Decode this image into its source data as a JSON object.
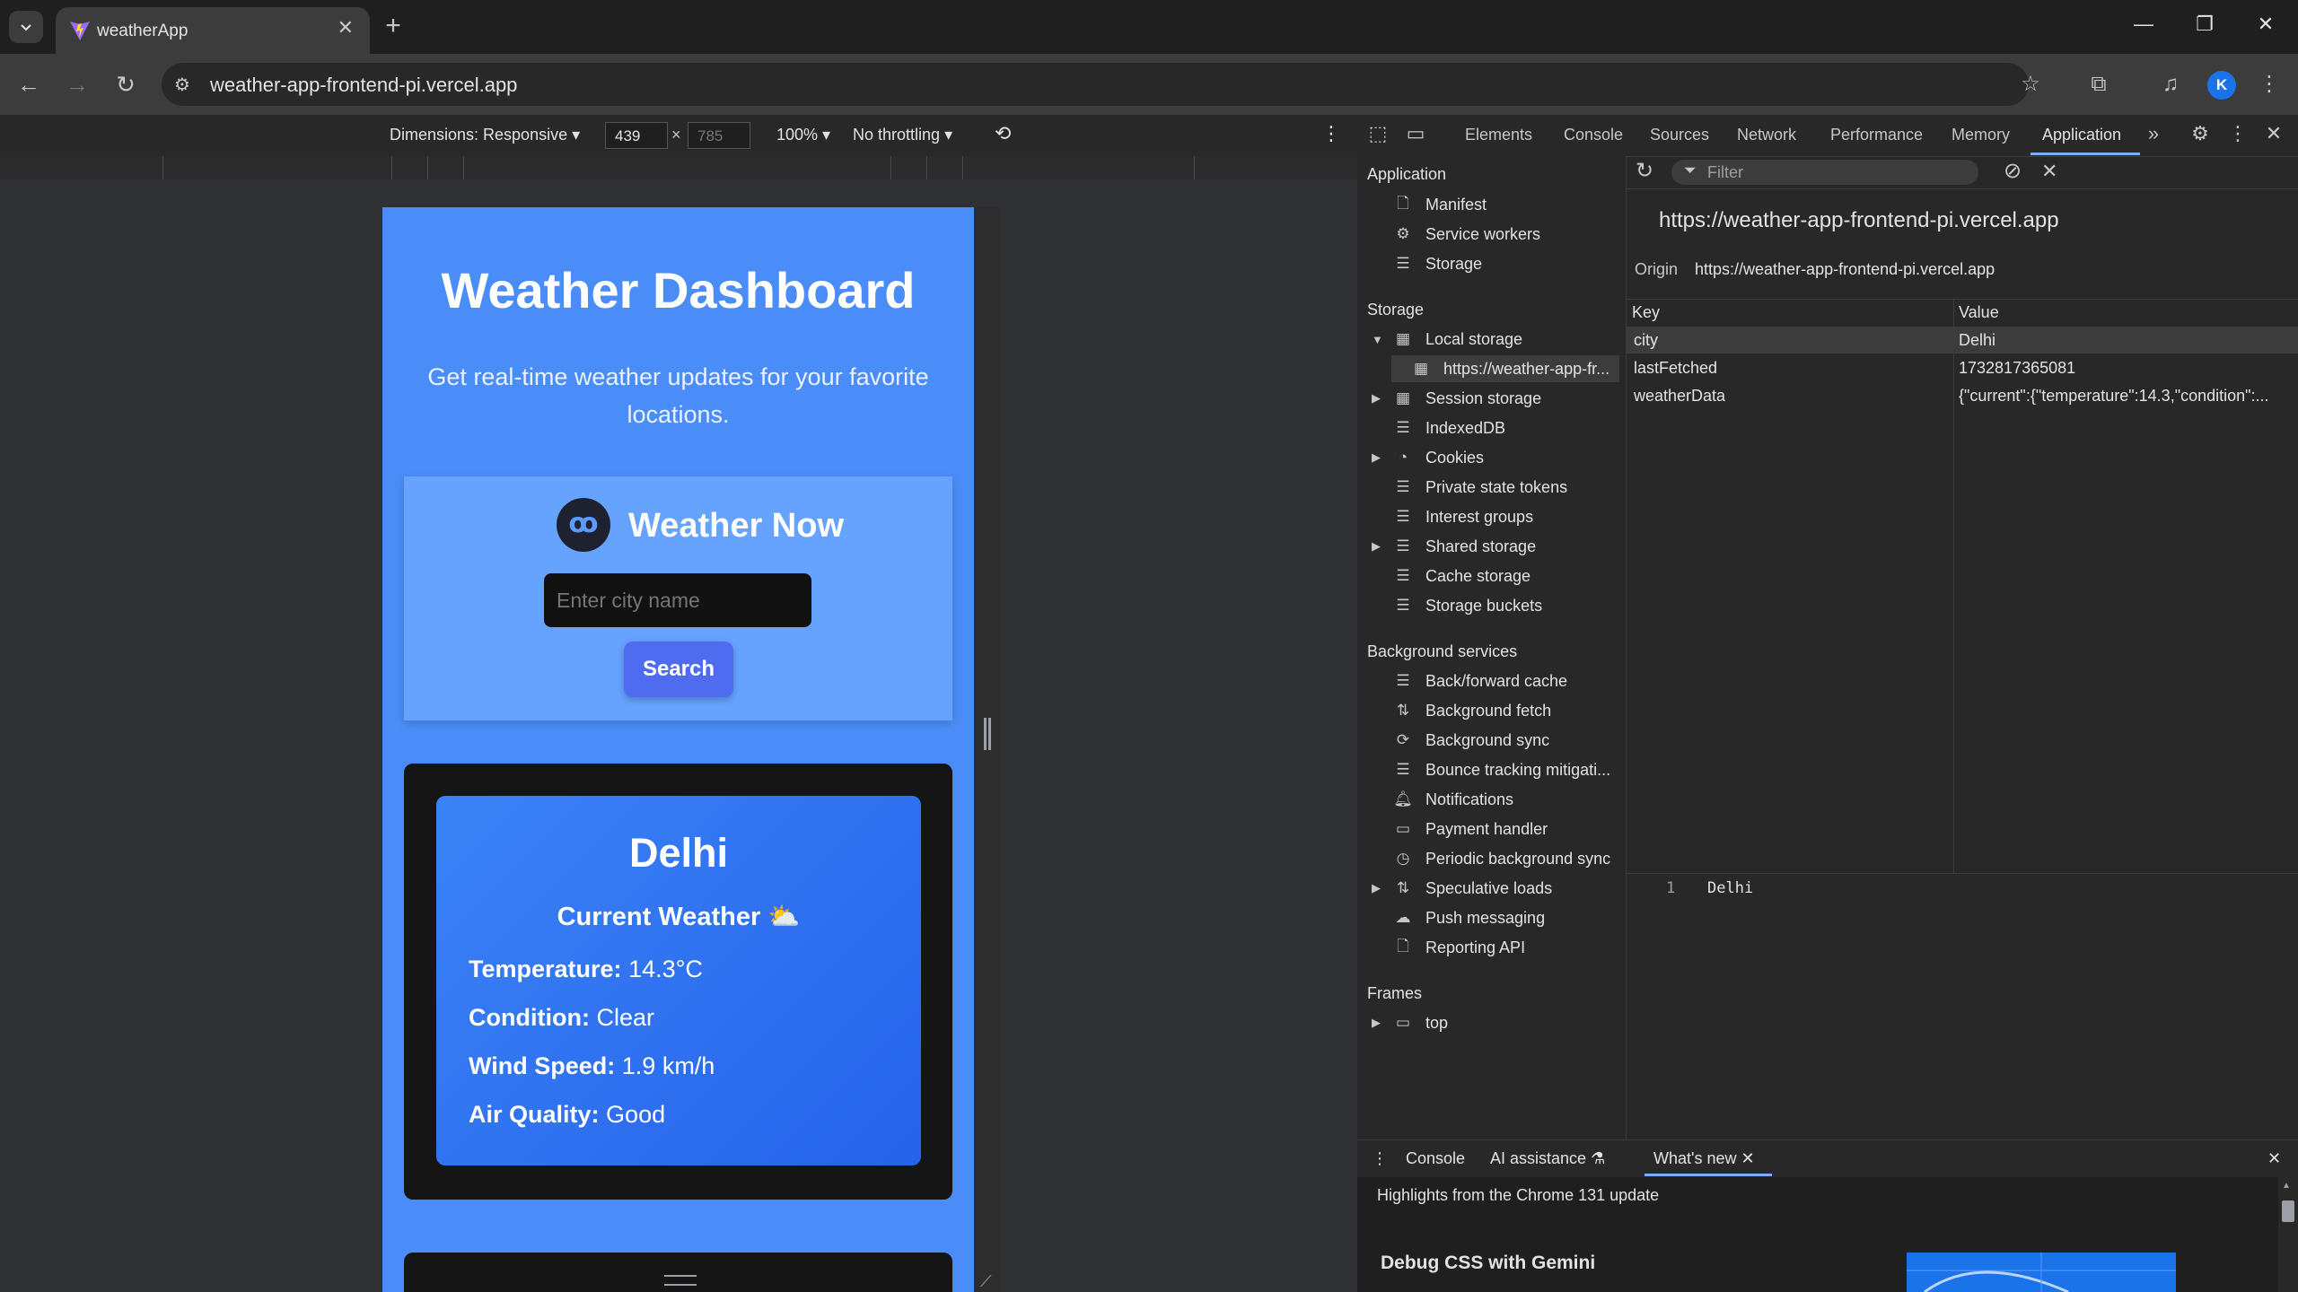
{
  "browser": {
    "tab_title": "weatherApp",
    "url": "weather-app-frontend-pi.vercel.app",
    "profile_initial": "K"
  },
  "device_toolbar": {
    "dimensions_label": "Dimensions: Responsive",
    "width": "439",
    "height": "785",
    "zoom": "100%",
    "throttling": "No throttling"
  },
  "page": {
    "title": "Weather Dashboard",
    "subtitle": "Get real-time weather updates for your favorite locations.",
    "widget_title": "Weather Now",
    "logo_glyph": "ꝏ",
    "search_placeholder": "Enter city name",
    "search_button": "Search",
    "city": "Delhi",
    "current_weather_label": "Current Weather",
    "weather_emoji": "⛅",
    "rows": [
      {
        "label": "Temperature:",
        "value": "14.3°C"
      },
      {
        "label": "Condition:",
        "value": "Clear"
      },
      {
        "label": "Wind Speed:",
        "value": "1.9 km/h"
      },
      {
        "label": "Air Quality:",
        "value": "Good"
      }
    ]
  },
  "devtools": {
    "tabs": [
      "Elements",
      "Console",
      "Sources",
      "Network",
      "Performance",
      "Memory",
      "Application"
    ],
    "active_tab": "Application",
    "sidebar": {
      "application_header": "Application",
      "application_items": [
        "Manifest",
        "Service workers",
        "Storage"
      ],
      "storage_header": "Storage",
      "storage_items": [
        "Local storage",
        "https://weather-app-fr...",
        "Session storage",
        "IndexedDB",
        "Cookies",
        "Private state tokens",
        "Interest groups",
        "Shared storage",
        "Cache storage",
        "Storage buckets"
      ],
      "background_header": "Background services",
      "background_items": [
        "Back/forward cache",
        "Background fetch",
        "Background sync",
        "Bounce tracking mitigati...",
        "Notifications",
        "Payment handler",
        "Periodic background sync",
        "Speculative loads",
        "Push messaging",
        "Reporting API"
      ],
      "frames_header": "Frames",
      "frames_items": [
        "top"
      ]
    },
    "filter_placeholder": "Filter",
    "origin_title": "https://weather-app-frontend-pi.vercel.app",
    "origin_label": "Origin",
    "origin_value": "https://weather-app-frontend-pi.vercel.app",
    "table": {
      "headers": [
        "Key",
        "Value"
      ],
      "rows": [
        {
          "key": "city",
          "value": "Delhi"
        },
        {
          "key": "lastFetched",
          "value": "1732817365081"
        },
        {
          "key": "weatherData",
          "value": "{\"current\":{\"temperature\":14.3,\"condition\":..."
        }
      ]
    },
    "preview": {
      "line": "1",
      "text": "Delhi"
    },
    "drawer": {
      "tabs": [
        "Console",
        "AI assistance",
        "What's new"
      ],
      "headline": "Highlights from the Chrome 131 update",
      "feature_title": "Debug CSS with Gemini"
    }
  }
}
